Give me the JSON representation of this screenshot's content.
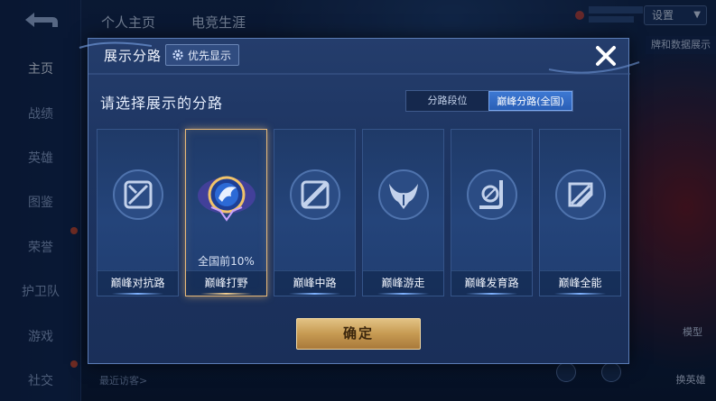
{
  "background": {
    "top_tabs": [
      "个人主页",
      "电竞生涯"
    ],
    "left_nav": [
      "主页",
      "战绩",
      "英雄",
      "图鉴",
      "荣誉",
      "护卫队",
      "游戏",
      "社交"
    ],
    "settings_label": "设置",
    "side_note": "牌和数据展示",
    "right_labels": [
      "模型",
      "换英雄"
    ],
    "recent_visitors": "最近访客>"
  },
  "modal": {
    "title": "展示分路",
    "priority_label": "优先显示",
    "subtitle": "请选择展示的分路",
    "segment": {
      "options": [
        "分路段位",
        "巅峰分路(全国)"
      ],
      "selected_index": 1
    },
    "cards": [
      {
        "label": "巅峰对抗路",
        "icon": "clash-lane-icon",
        "rank_text": "",
        "selected": false
      },
      {
        "label": "巅峰打野",
        "icon": "jungle-emblem-icon",
        "rank_text": "全国前10%",
        "selected": true
      },
      {
        "label": "巅峰中路",
        "icon": "mid-lane-icon",
        "rank_text": "",
        "selected": false
      },
      {
        "label": "巅峰游走",
        "icon": "roam-wings-icon",
        "rank_text": "",
        "selected": false
      },
      {
        "label": "巅峰发育路",
        "icon": "farm-lane-icon",
        "rank_text": "",
        "selected": false
      },
      {
        "label": "巅峰全能",
        "icon": "all-round-icon",
        "rank_text": "",
        "selected": false
      }
    ],
    "confirm_label": "确定",
    "close_icon": "close-x-icon"
  },
  "colors": {
    "accent_blue": "#3d78d3",
    "selected_gold": "#e8b978",
    "confirm_gold": "#c69a52"
  }
}
